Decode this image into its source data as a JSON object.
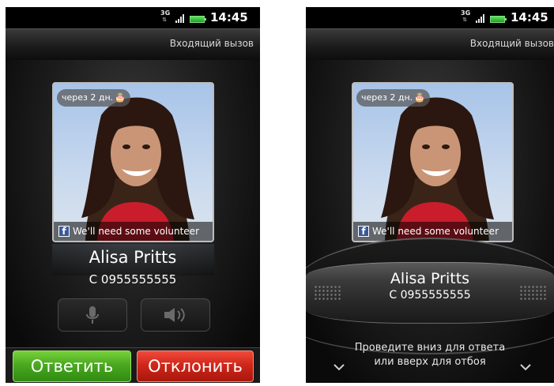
{
  "left_phone": {
    "status": {
      "network": "3G",
      "time": "14:45"
    },
    "title": "Входящий вызов",
    "badge": "через 2 дн.",
    "facebook_status": "We'll need some volunteer",
    "caller_name": "Alisa Pritts",
    "caller_number": "C 0955555555",
    "answer_label": "Ответить",
    "decline_label": "Отклонить"
  },
  "right_phone": {
    "status": {
      "network": "3G",
      "time": "14:45"
    },
    "title": "Входящий вызов",
    "badge": "через 2 дн.",
    "facebook_status": "We'll need some volunteer",
    "caller_name": "Alisa Pritts",
    "caller_number": "C 0955555555",
    "hint_line1": "Проведите вниз для ответа",
    "hint_line2": "или вверх для отбоя"
  },
  "colors": {
    "answer": "#4aa820",
    "decline": "#d0271a",
    "facebook": "#3b5998"
  },
  "icons": [
    "mute-icon",
    "speaker-icon",
    "cake-icon",
    "facebook-icon",
    "signal-icon",
    "battery-icon",
    "chevron-down-icon"
  ]
}
